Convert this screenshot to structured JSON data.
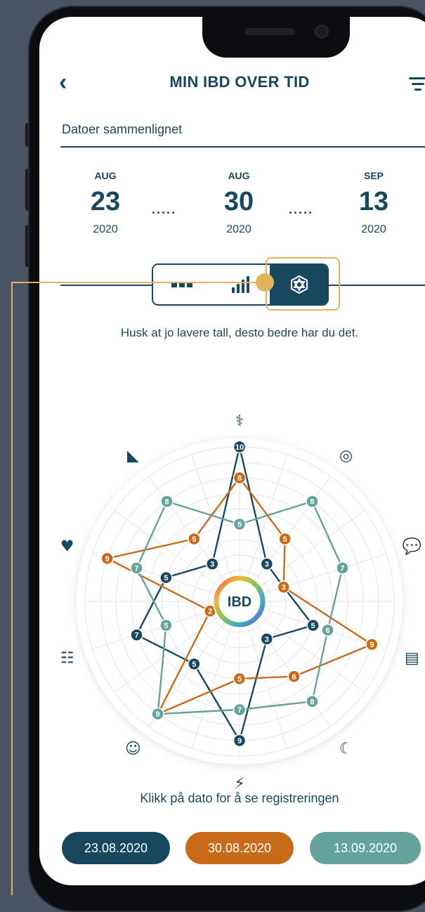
{
  "header": {
    "title": "MIN IBD OVER TID",
    "back_icon": "chevron-left-icon",
    "filter_icon": "filter-icon"
  },
  "compare": {
    "label": "Datoer sammenlignet"
  },
  "dates": [
    {
      "month": "AUG",
      "day": "23",
      "year": "2020"
    },
    {
      "month": "AUG",
      "day": "30",
      "year": "2020"
    },
    {
      "month": "SEP",
      "day": "13",
      "year": "2020"
    }
  ],
  "dates_separator": ".....",
  "view_toggle": {
    "options": [
      "dots-view",
      "bar-view",
      "radar-view"
    ],
    "selected": "radar-view"
  },
  "hint": "Husk at jo lavere tall, desto bedre har du det.",
  "chart_data": {
    "type": "radar",
    "center_label": "IBD",
    "axes": [
      "ibd-person-icon",
      "toilet-paper-icon",
      "chat-icon",
      "document-icon",
      "sleep-moon-icon",
      "energy-bolt-icon",
      "mood-faces-icon",
      "social-icon",
      "heart-icon",
      "joint-icon"
    ],
    "max": 10,
    "series": [
      {
        "color": "#17485f",
        "values": [
          10,
          3,
          3,
          5,
          3,
          9,
          5,
          7,
          5,
          3
        ]
      },
      {
        "color": "#c76b1a",
        "values": [
          8,
          5,
          3,
          9,
          6,
          5,
          9,
          2,
          9,
          5
        ]
      },
      {
        "color": "#64a39b",
        "values": [
          5,
          8,
          7,
          6,
          8,
          7,
          9,
          5,
          7,
          8
        ]
      }
    ]
  },
  "footer": {
    "text": "Klikk på dato for å se registreringen"
  },
  "date_buttons": [
    {
      "label": "23.08.2020",
      "color": "#17485f"
    },
    {
      "label": "30.08.2020",
      "color": "#c76b1a"
    },
    {
      "label": "13.09.2020",
      "color": "#64a39b"
    }
  ]
}
